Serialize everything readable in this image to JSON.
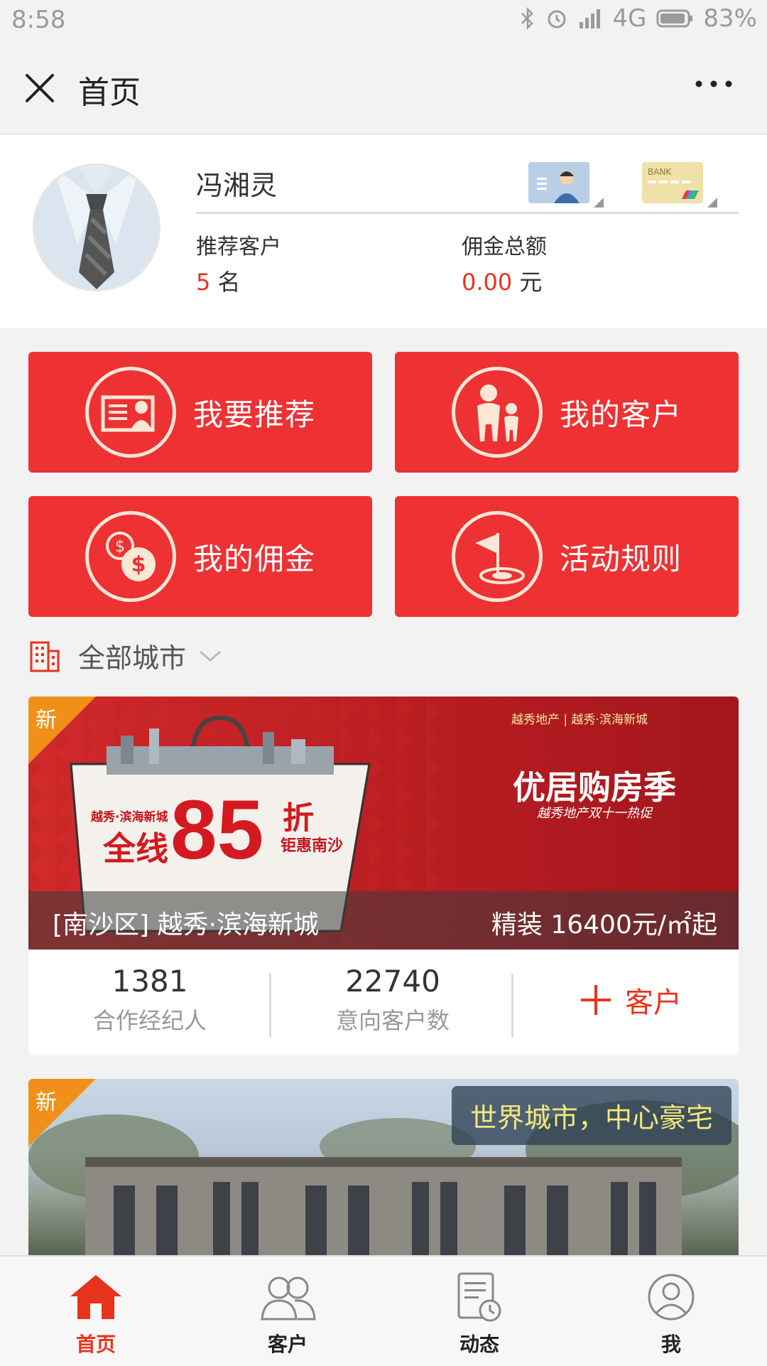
{
  "status_bar": {
    "time": "8:58",
    "network": "4G",
    "battery": "83%"
  },
  "header": {
    "title": "首页"
  },
  "profile": {
    "name": "冯湘灵",
    "stats": [
      {
        "label": "推荐客户",
        "value": "5",
        "unit": "名"
      },
      {
        "label": "佣金总额",
        "value": "0.00",
        "unit": "元"
      }
    ]
  },
  "actions": [
    {
      "label": "我要推荐"
    },
    {
      "label": "我的客户"
    },
    {
      "label": "我的佣金"
    },
    {
      "label": "活动规则"
    }
  ],
  "city_filter": {
    "label": "全部城市"
  },
  "projects": [
    {
      "badge": "新",
      "caption_left": "[南沙区] 越秀·滨海新城",
      "caption_right": "精装 16400元/㎡起",
      "banner_texts": {
        "brand": "越秀地产 | 越秀·滨海新城",
        "headline": "优居购房季",
        "sub": "越秀地产双十一热促",
        "discount_prefix": "全线",
        "discount": "85",
        "discount_suffix": "折",
        "promo": "钜惠南沙",
        "project": "越秀·滨海新城"
      },
      "stats": [
        {
          "value": "1381",
          "label": "合作经纪人"
        },
        {
          "value": "22740",
          "label": "意向客户数"
        }
      ],
      "add_label": "客户"
    },
    {
      "badge": "新",
      "slogan": "世界城市，中心豪宅"
    }
  ],
  "tabs": [
    {
      "label": "首页"
    },
    {
      "label": "客户"
    },
    {
      "label": "动态"
    },
    {
      "label": "我"
    }
  ],
  "colors": {
    "accent": "#ee3133",
    "price_red": "#e8331d",
    "badge_orange": "#f0901a"
  }
}
